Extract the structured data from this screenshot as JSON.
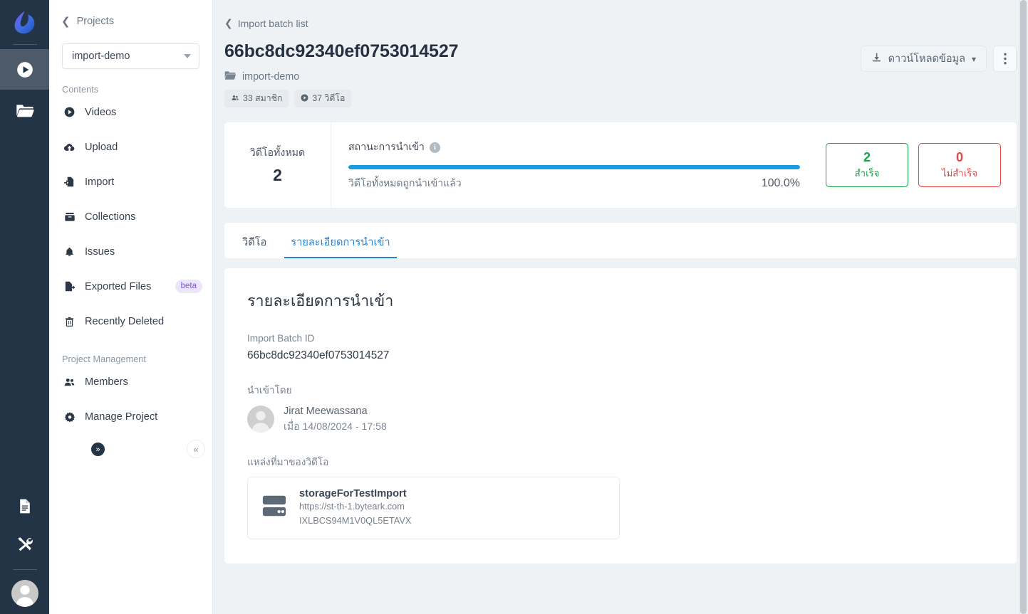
{
  "rail": {
    "logo_icon": "byteark-logo-icon",
    "items": [
      {
        "icon": "play-circle-icon",
        "name": "rail-item-videos",
        "active": true
      },
      {
        "icon": "folder-open-icon",
        "name": "rail-item-projects",
        "active": false
      }
    ],
    "bottom_items": [
      {
        "icon": "document-icon",
        "name": "rail-item-docs"
      },
      {
        "icon": "tools-icon",
        "name": "rail-item-tools"
      }
    ],
    "avatar": "user-avatar-icon"
  },
  "sidebar": {
    "back_label": "Projects",
    "project_select_value": "import-demo",
    "groups": [
      {
        "label": "Contents",
        "items": [
          {
            "label": "Videos",
            "icon": "play-circle-icon",
            "badge": null
          },
          {
            "label": "Upload",
            "icon": "cloud-upload-icon",
            "badge": null
          },
          {
            "label": "Import",
            "icon": "import-file-icon",
            "badge": null
          },
          {
            "label": "Collections",
            "icon": "collection-icon",
            "badge": null
          },
          {
            "label": "Issues",
            "icon": "bell-icon",
            "badge": null
          },
          {
            "label": "Exported Files",
            "icon": "export-file-icon",
            "badge": "beta"
          },
          {
            "label": "Recently Deleted",
            "icon": "trash-icon",
            "badge": null
          }
        ]
      },
      {
        "label": "Project Management",
        "items": [
          {
            "label": "Members",
            "icon": "people-icon",
            "badge": null
          },
          {
            "label": "Manage Project",
            "icon": "gear-icon",
            "badge": null
          }
        ]
      }
    ],
    "collapse_icon": "chevron-double-left-icon",
    "expand_icon": "chevron-double-right-icon"
  },
  "header": {
    "breadcrumb": "Import batch list",
    "title": "66bc8dc92340ef0753014527",
    "project_name": "import-demo",
    "project_icon": "folder-icon",
    "chips": [
      {
        "icon": "people-icon",
        "text": "33 สมาชิก"
      },
      {
        "icon": "play-circle-icon",
        "text": "37 วิดีโอ"
      }
    ],
    "download_button": "ดาวน์โหลดข้อมูล",
    "download_icon": "download-icon",
    "download_caret_icon": "chevron-down-icon",
    "kebab_icon": "kebab-menu-icon"
  },
  "stats": {
    "total_label": "วิดีโอทั้งหมด",
    "total_value": "2",
    "progress_label": "สถานะการนำเข้า",
    "info_icon": "info-icon",
    "progress_caption": "วิดีโอทั้งหมดถูกนำเข้าแล้ว",
    "progress_percent_text": "100.0%",
    "progress_percent": 100,
    "success": {
      "value": "2",
      "label": "สำเร็จ",
      "color": "#16a34a"
    },
    "failed": {
      "value": "0",
      "label": "ไม่สำเร็จ",
      "color": "#e84545"
    }
  },
  "tabs": [
    {
      "label": "วิดีโอ",
      "active": false
    },
    {
      "label": "รายละเอียดการนำเข้า",
      "active": true
    }
  ],
  "detail": {
    "title": "รายละเอียดการนำเข้า",
    "batch_id_label": "Import Batch ID",
    "batch_id_value": "66bc8dc92340ef0753014527",
    "imported_by_label": "นำเข้าโดย",
    "imported_by_name": "Jirat Meewassana",
    "imported_by_time": "เมื่อ 14/08/2024 - 17:58",
    "source_label": "แหล่งที่มาของวิดีโอ",
    "source_icon": "storage-server-icon",
    "source_name": "storageForTestImport",
    "source_url": "https://st-th-1.byteark.com",
    "source_key": "IXLBCS94M1V0QL5ETAVX"
  },
  "colors": {
    "accent_blue": "#2684d8",
    "progress_blue": "#179ce0",
    "rail_bg": "#243447",
    "page_bg": "#eef2f5",
    "success": "#16a34a",
    "danger": "#e84545"
  }
}
